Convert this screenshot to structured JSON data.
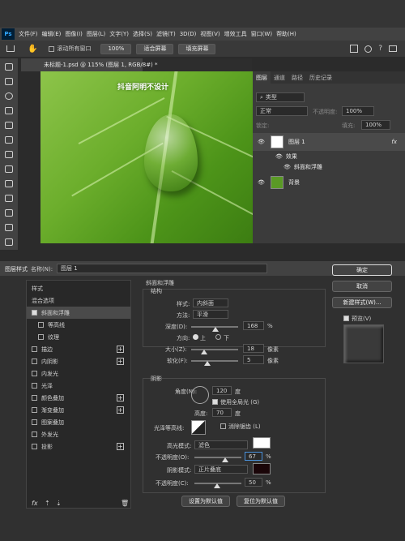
{
  "menu": [
    "文件(F)",
    "编辑(E)",
    "图像(I)",
    "图层(L)",
    "文字(Y)",
    "选择(S)",
    "滤镜(T)",
    "3D(D)",
    "视图(V)",
    "增效工具",
    "窗口(W)",
    "帮助(H)"
  ],
  "ps_logo": "Ps",
  "options": {
    "scroll_all": "滚动所有窗口",
    "zoom": "100%",
    "fit": "适合屏幕",
    "fill": "填充屏幕"
  },
  "doc_tab": "未标题-1.psd @ 115% (图层 1, RGB/8#) *",
  "watermark": "抖音阿明不设计",
  "layers_panel": {
    "tabs": [
      "图层",
      "通道",
      "路径",
      "历史记录"
    ],
    "filter": "类型",
    "blend": "正常",
    "opacity_label": "不透明度:",
    "opacity": "100%",
    "lock_label": "锁定:",
    "fill_label": "填充:",
    "fill": "100%",
    "layers": [
      {
        "name": "图层 1",
        "fx": "fx"
      },
      {
        "name": "效果"
      },
      {
        "name": "斜面和浮雕"
      },
      {
        "name": "背景"
      }
    ]
  },
  "dialog": {
    "title": "图层样式",
    "name_label": "名称(N):",
    "name_value": "图层 1",
    "styles_header": "样式",
    "blend_options": "混合选项",
    "fx_items": [
      {
        "label": "斜面和浮雕",
        "checked": true,
        "plus": false,
        "active": true
      },
      {
        "label": "等高线",
        "checked": false,
        "plus": false,
        "indent": true
      },
      {
        "label": "纹理",
        "checked": false,
        "plus": false,
        "indent": true
      },
      {
        "label": "描边",
        "checked": false,
        "plus": true
      },
      {
        "label": "内阴影",
        "checked": false,
        "plus": true
      },
      {
        "label": "内发光",
        "checked": false,
        "plus": false
      },
      {
        "label": "光泽",
        "checked": false,
        "plus": false
      },
      {
        "label": "颜色叠加",
        "checked": false,
        "plus": true
      },
      {
        "label": "渐变叠加",
        "checked": false,
        "plus": true
      },
      {
        "label": "图案叠加",
        "checked": false,
        "plus": false
      },
      {
        "label": "外发光",
        "checked": false,
        "plus": false
      },
      {
        "label": "投影",
        "checked": false,
        "plus": true
      }
    ],
    "bevel": {
      "section": "斜面和浮雕",
      "structure": "结构",
      "style_label": "样式:",
      "style": "内斜面",
      "technique_label": "方法:",
      "technique": "平滑",
      "depth_label": "深度(D):",
      "depth": "168",
      "depth_unit": "%",
      "direction_label": "方向:",
      "dir_up": "上",
      "dir_down": "下",
      "size_label": "大小(Z):",
      "size": "18",
      "soften_label": "软化(F):",
      "soften": "5",
      "px": "像素"
    },
    "shading": {
      "section": "阴影",
      "angle_label": "角度(N):",
      "angle": "120",
      "angle_unit": "度",
      "global_light": "使用全局光 (G)",
      "altitude_label": "高度:",
      "altitude": "70",
      "altitude_unit": "度",
      "gloss_label": "光泽等高线:",
      "antialias": "消除锯齿 (L)",
      "highlight_label": "高光模式:",
      "highlight_mode": "滤色",
      "highlight_opacity_label": "不透明度(O):",
      "highlight_opacity": "67",
      "shadow_label": "阴影模式:",
      "shadow_mode": "正片叠底",
      "shadow_opacity_label": "不透明度(C):",
      "shadow_opacity": "50",
      "pct": "%"
    },
    "defaults": {
      "set": "设置为默认值",
      "reset": "复位为默认值"
    },
    "buttons": {
      "ok": "确定",
      "cancel": "取消",
      "new_style": "新建样式(W)...",
      "preview": "预览(V)"
    },
    "footer_fx": "fx"
  },
  "colors": {
    "highlight": "#ffffff",
    "shadow": "#1a0508",
    "accent": "#4a90d9"
  }
}
